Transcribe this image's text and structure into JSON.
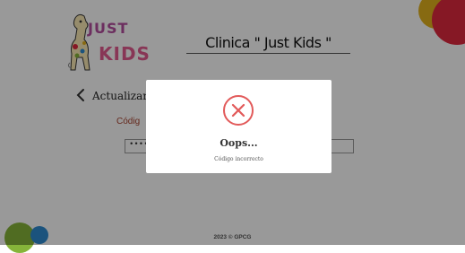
{
  "logo": {
    "line1": "JUST",
    "line2": "KIDS"
  },
  "header": {
    "title": "Clinica \" Just Kids \""
  },
  "nav": {
    "back_icon": "chevron-left-icon",
    "page_title_partial": "Actualizar c"
  },
  "form": {
    "code_label_partial": "Códig",
    "code_value": "••••••••••"
  },
  "footer": {
    "copyright": "2023 © GPCG"
  },
  "modal": {
    "icon": "error-x-circle-icon",
    "title": "Oops...",
    "message": "Código incorrecto"
  },
  "colors": {
    "accent_red": "#e0283f",
    "accent_yellow": "#e2b11d",
    "accent_green": "#86b43a",
    "accent_blue": "#2d8bd0",
    "error_icon": "#e25a5a",
    "label_brown": "#a8432f"
  }
}
